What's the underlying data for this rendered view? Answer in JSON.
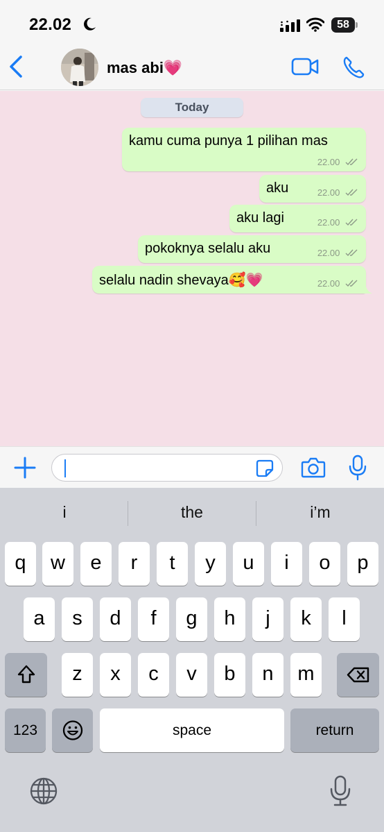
{
  "status_bar": {
    "time": "22.02",
    "battery": "58",
    "icons": [
      "moon-icon",
      "signal-icon",
      "wifi-icon",
      "battery-icon"
    ]
  },
  "header": {
    "contact_name": "mas abi💗",
    "icons": [
      "back-chevron-icon",
      "video-call-icon",
      "phone-icon"
    ],
    "accent_color": "#1a7cf5"
  },
  "chat": {
    "date_label": "Today",
    "background_color": "#f5dfe7",
    "bubble_color": "#d9fcc6",
    "messages": [
      {
        "text": "kamu cuma punya 1 pilihan mas",
        "time": "22.00",
        "status": "read"
      },
      {
        "text": "aku",
        "time": "22.00",
        "status": "read"
      },
      {
        "text": "aku lagi",
        "time": "22.00",
        "status": "read"
      },
      {
        "text": "pokoknya selalu aku",
        "time": "22.00",
        "status": "read"
      },
      {
        "text": "selalu nadin shevaya🥰💗",
        "time": "22.00",
        "status": "read"
      }
    ]
  },
  "input_bar": {
    "value": "",
    "icons": [
      "plus-icon",
      "sticker-icon",
      "camera-icon",
      "microphone-icon"
    ]
  },
  "keyboard": {
    "suggestions": [
      "i",
      "the",
      "i’m"
    ],
    "row1": [
      "q",
      "w",
      "e",
      "r",
      "t",
      "y",
      "u",
      "i",
      "o",
      "p"
    ],
    "row2": [
      "a",
      "s",
      "d",
      "f",
      "g",
      "h",
      "j",
      "k",
      "l"
    ],
    "row3": [
      "z",
      "x",
      "c",
      "v",
      "b",
      "n",
      "m"
    ],
    "numbers_label": "123",
    "space_label": "space",
    "return_label": "return",
    "icons": [
      "shift-icon",
      "delete-icon",
      "emoji-icon",
      "globe-icon",
      "dictation-icon"
    ]
  }
}
